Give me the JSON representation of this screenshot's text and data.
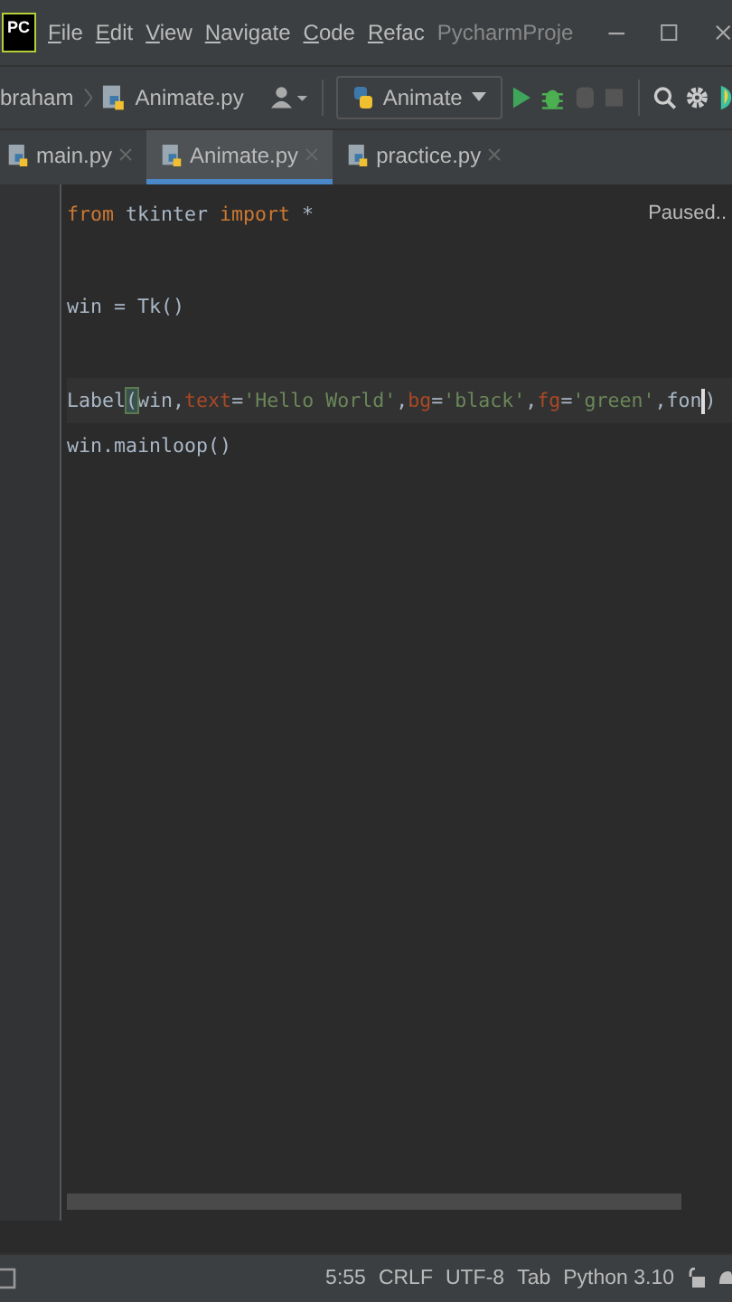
{
  "window": {
    "logo": "PC",
    "menu": [
      "File",
      "Edit",
      "View",
      "Navigate",
      "Code",
      "Refac"
    ],
    "title": "PycharmProje"
  },
  "navbar": {
    "breadcrumb": "braham",
    "file": "Animate.py",
    "run_config": "Animate"
  },
  "tabs": [
    {
      "label": "main.py",
      "selected": false
    },
    {
      "label": "Animate.py",
      "selected": true
    },
    {
      "label": "practice.py",
      "selected": false
    }
  ],
  "editor": {
    "status": "Paused..",
    "lines": [
      [
        {
          "kind": "keyword",
          "text": "from"
        },
        {
          "kind": "plain",
          "text": " tkinter "
        },
        {
          "kind": "keyword",
          "text": "import"
        },
        {
          "kind": "plain",
          "text": " *"
        }
      ],
      [
        {
          "kind": "blank"
        }
      ],
      [
        {
          "kind": "plain",
          "text": "win = Tk()"
        }
      ],
      [
        {
          "kind": "blank"
        }
      ],
      [
        {
          "kind": "plain",
          "text": "Label"
        },
        {
          "kind": "match",
          "text": "("
        },
        {
          "kind": "plain",
          "text": "win,"
        },
        {
          "kind": "param",
          "text": "text"
        },
        {
          "kind": "plain",
          "text": "="
        },
        {
          "kind": "string",
          "text": "'Hello World'"
        },
        {
          "kind": "plain",
          "text": ","
        },
        {
          "kind": "param",
          "text": "bg"
        },
        {
          "kind": "plain",
          "text": "="
        },
        {
          "kind": "string",
          "text": "'black'"
        },
        {
          "kind": "plain",
          "text": ","
        },
        {
          "kind": "param",
          "text": "fg"
        },
        {
          "kind": "plain",
          "text": "="
        },
        {
          "kind": "string",
          "text": "'green'"
        },
        {
          "kind": "plain",
          "text": ",fon"
        },
        {
          "kind": "cursor"
        },
        {
          "kind": "plain",
          "text": ")"
        }
      ],
      [
        {
          "kind": "plain",
          "text": "win.mainloop()"
        }
      ]
    ]
  },
  "status_bar": {
    "items": [
      "5:55",
      "CRLF",
      "UTF-8",
      "Tab",
      "Python 3.10"
    ]
  }
}
